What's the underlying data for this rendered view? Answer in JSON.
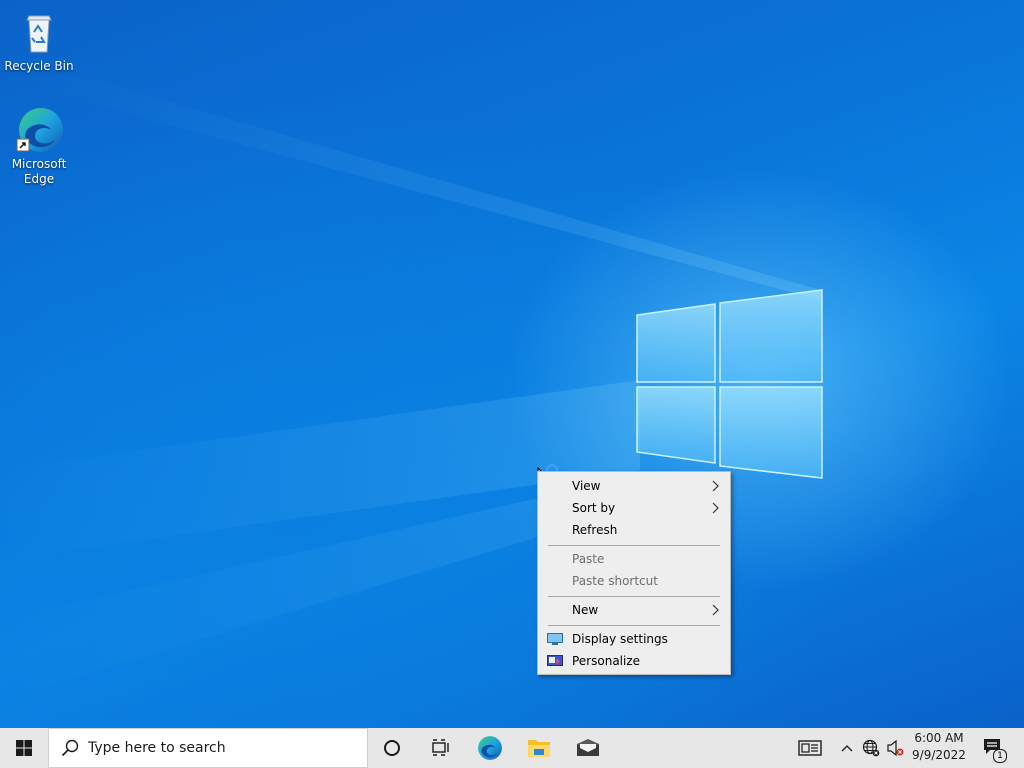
{
  "desktop": {
    "icons": [
      {
        "label": "Recycle Bin",
        "icon": "recycle-bin-icon"
      },
      {
        "label": "Microsoft Edge",
        "icon": "edge-icon"
      }
    ]
  },
  "context_menu": {
    "items": [
      {
        "label": "View",
        "submenu": true,
        "enabled": true
      },
      {
        "label": "Sort by",
        "submenu": true,
        "enabled": true
      },
      {
        "label": "Refresh",
        "submenu": false,
        "enabled": true
      },
      {
        "label": "Paste",
        "submenu": false,
        "enabled": false
      },
      {
        "label": "Paste shortcut",
        "submenu": false,
        "enabled": false
      },
      {
        "label": "New",
        "submenu": true,
        "enabled": true
      },
      {
        "label": "Display settings",
        "submenu": false,
        "enabled": true,
        "icon": "display-icon"
      },
      {
        "label": "Personalize",
        "submenu": false,
        "enabled": true,
        "icon": "personalize-icon"
      }
    ]
  },
  "taskbar": {
    "search_placeholder": "Type here to search",
    "pinned": [
      "cortana-icon",
      "task-view-icon",
      "edge-icon",
      "file-explorer-icon",
      "mail-icon"
    ],
    "tray": [
      "news-icon",
      "show-hidden-icons-chevron",
      "network-icon",
      "volume-muted-icon",
      "notifications-icon"
    ],
    "clock": {
      "time": "6:00 AM",
      "date": "9/9/2022"
    },
    "notification_count": "1"
  },
  "colors": {
    "accent": "#0078d7",
    "taskbar_bg": "#e7e7e7",
    "menu_bg": "#eeeeee",
    "disabled_text": "#6d6d6d"
  }
}
